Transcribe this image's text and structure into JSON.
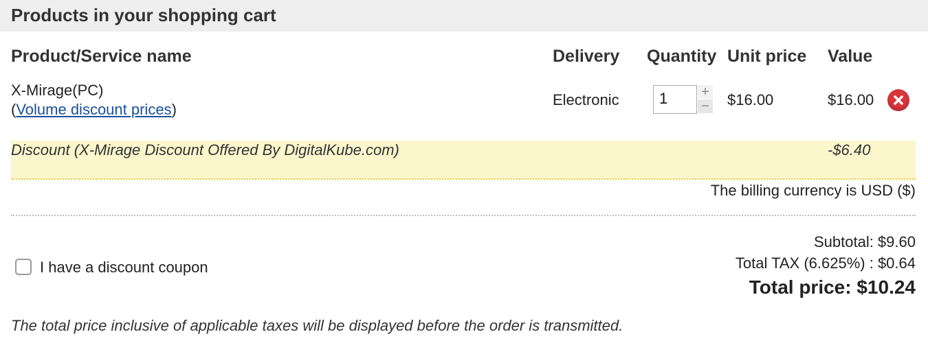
{
  "header": {
    "title": "Products in your shopping cart"
  },
  "columns": {
    "product": "Product/Service name",
    "delivery": "Delivery",
    "quantity": "Quantity",
    "unit_price": "Unit price",
    "value": "Value"
  },
  "item": {
    "name": "X-Mirage(PC)",
    "paren_open": "(",
    "discount_link": "Volume discount prices",
    "paren_close": ")",
    "delivery": "Electronic",
    "quantity": "1",
    "unit_price": "$16.00",
    "value": "$16.00",
    "stepper_up": "+",
    "stepper_down": "−"
  },
  "discount": {
    "label": "Discount (X-Mirage Discount Offered By DigitalKube.com)",
    "amount": "-$6.40"
  },
  "currency_note": "The billing currency is USD ($)",
  "coupon": {
    "label": "I have a discount coupon",
    "checked": false
  },
  "totals": {
    "subtotal": "Subtotal: $9.60",
    "tax": "Total TAX (6.625%) : $0.64",
    "total": "Total price: $10.24"
  },
  "footer_note": "The total price inclusive of applicable taxes will be displayed before the order is transmitted.",
  "colors": {
    "header_bg": "#eeeeee",
    "link": "#1a4f9c",
    "discount_bg": "#fbf6cc",
    "remove_icon": "#d9343a"
  }
}
